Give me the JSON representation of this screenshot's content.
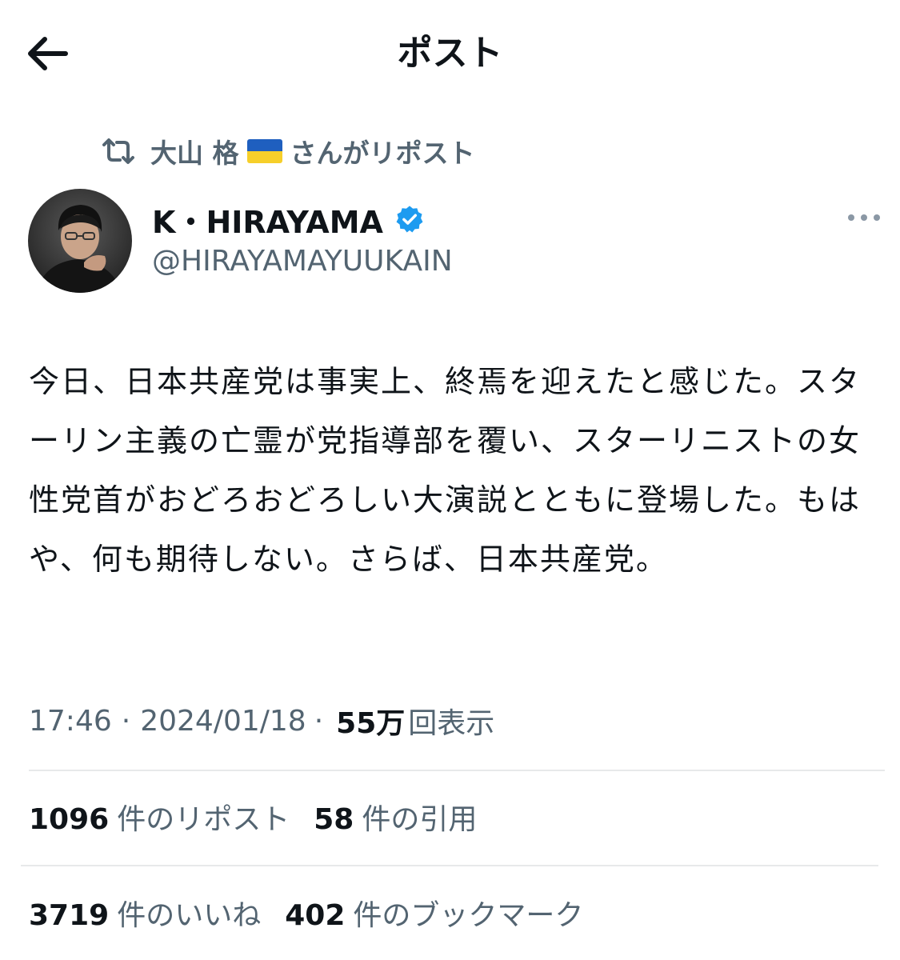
{
  "header": {
    "title": "ポスト",
    "back_icon": "arrow-left-icon"
  },
  "repost": {
    "icon": "repost-icon",
    "user": "大山 格",
    "flag": "ukraine-flag",
    "suffix": "さんがリポスト"
  },
  "author": {
    "name": "K・HIRAYAMA",
    "handle": "@HIRAYAMAYUUKAIN",
    "verified": true,
    "verified_color": "#1d9bf0"
  },
  "post": {
    "text": "今日、日本共産党は事実上、終焉を迎えたと感じた。スターリン主義の亡霊が党指導部を覆い、スターリニストの女性党首がおどろおどろしい大演説とともに登場した。もはや、何も期待しない。さらば、日本共産党。"
  },
  "meta": {
    "time": "17:46",
    "sep1": "·",
    "date": "2024/01/18",
    "sep2": "·",
    "views": "55万",
    "views_label": "回表示"
  },
  "stats": {
    "reposts": {
      "count": "1096",
      "label": "件のリポスト"
    },
    "quotes": {
      "count": "58",
      "label": "件の引用"
    },
    "likes": {
      "count": "3719",
      "label": "件のいいね"
    },
    "bookmarks": {
      "count": "402",
      "label": "件のブックマーク"
    }
  },
  "colors": {
    "text": "#0f1419",
    "secondary": "#536471",
    "accent": "#1d9bf0",
    "divider": "#e7e9ea"
  }
}
